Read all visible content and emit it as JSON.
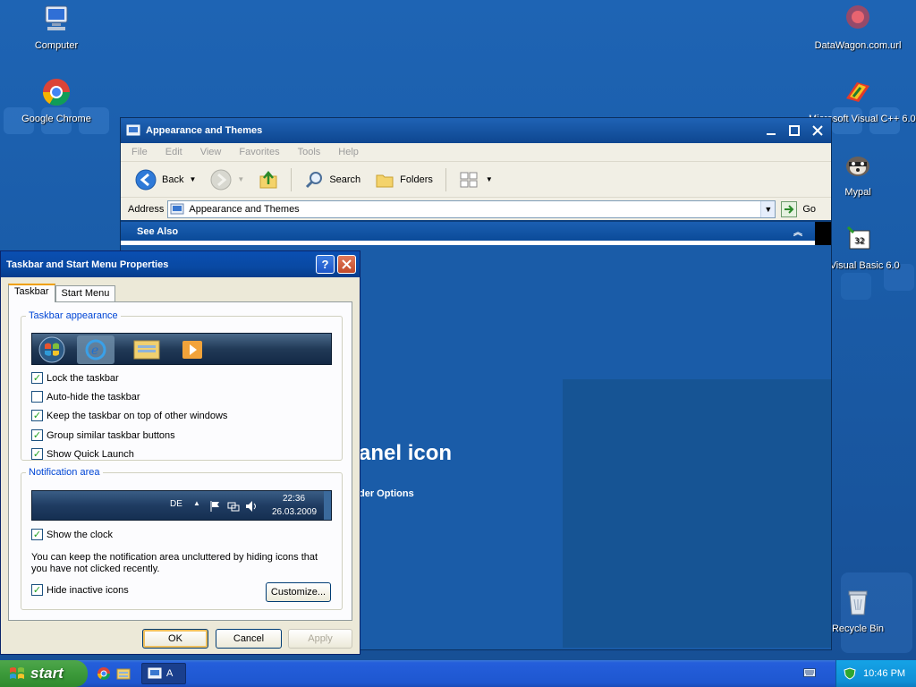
{
  "desktop": {
    "icons": [
      {
        "label": "Computer",
        "icon": "computer-icon"
      },
      {
        "label": "Google Chrome",
        "icon": "chrome-icon"
      },
      {
        "label": "DataWagon.com.url",
        "icon": "datawagon-icon"
      },
      {
        "label": "Microsoft Visual C++ 6.0",
        "icon": "visual-cpp-icon"
      },
      {
        "label": "Mypal",
        "icon": "mypal-icon"
      },
      {
        "label": "oft Visual Basic 6.0",
        "icon": "visual-basic-icon"
      },
      {
        "label": "Recycle Bin",
        "icon": "recycle-bin-icon"
      }
    ]
  },
  "explorer": {
    "title": "Appearance and Themes",
    "menu": [
      "File",
      "Edit",
      "View",
      "Favorites",
      "Tools",
      "Help"
    ],
    "toolbar": {
      "back": "Back",
      "search": "Search",
      "folders": "Folders"
    },
    "address_label": "Address",
    "address_value": "Appearance and Themes",
    "go_label": "Go",
    "see_also": "See Also",
    "content_heading": "anel icon",
    "content_link": "der Options"
  },
  "dialog": {
    "title": "Taskbar and Start Menu Properties",
    "tabs": [
      "Taskbar",
      "Start Menu"
    ],
    "taskbar_group": "Taskbar appearance",
    "options": [
      {
        "label": "Lock the taskbar",
        "checked": true
      },
      {
        "label": "Auto-hide the taskbar",
        "checked": false
      },
      {
        "label": "Keep the taskbar on top of other windows",
        "checked": true
      },
      {
        "label": "Group similar taskbar buttons",
        "checked": true
      },
      {
        "label": "Show Quick Launch",
        "checked": true
      }
    ],
    "notification_group": "Notification area",
    "notif_preview": {
      "lang": "DE",
      "time": "22:36",
      "date": "26.03.2009"
    },
    "show_clock": "Show the clock",
    "note": "You can keep the notification area uncluttered by hiding icons that you have not clicked recently.",
    "hide_inactive": "Hide inactive icons",
    "customize": "Customize...",
    "ok": "OK",
    "cancel": "Cancel",
    "apply": "Apply"
  },
  "taskbar": {
    "start": "start",
    "task_label": "A",
    "clock": "10:46 PM"
  },
  "colors": {
    "accent": "#0a4fb2",
    "start_green": "#3c9a3a",
    "group_label": "#0046d5"
  }
}
